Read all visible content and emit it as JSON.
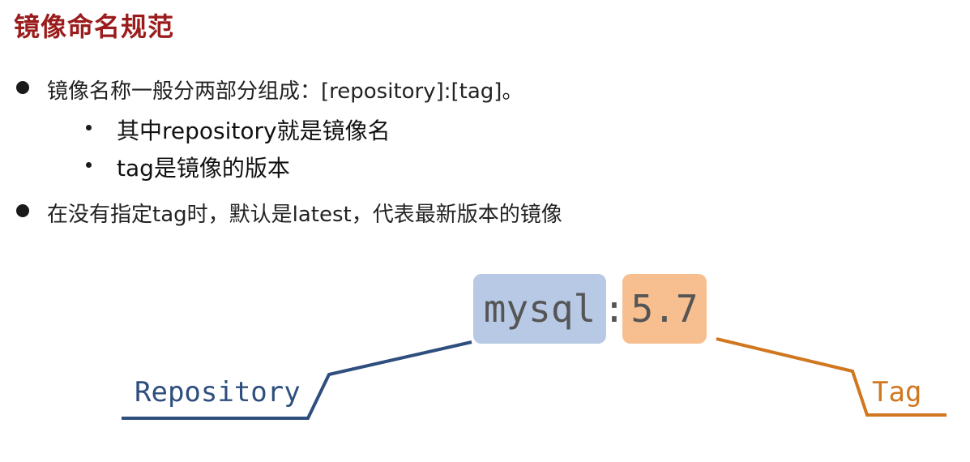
{
  "title": "镜像命名规范",
  "bullets": [
    {
      "text": "镜像名称一般分两部分组成：[repository]:[tag]。"
    },
    {
      "text": "在没有指定tag时，默认是latest，代表最新版本的镜像"
    }
  ],
  "sub_bullets": [
    {
      "text": "其中repository就是镜像名"
    },
    {
      "text": "tag是镜像的版本"
    }
  ],
  "diagram": {
    "repository_value": "mysql",
    "separator": ":",
    "tag_value": "5.7",
    "repository_label": "Repository",
    "tag_label": "Tag",
    "colors": {
      "repository_box": "#b8c9e6",
      "tag_box": "#f7bf90",
      "repository_line": "#2e4f7d",
      "tag_line": "#d0771f"
    }
  }
}
